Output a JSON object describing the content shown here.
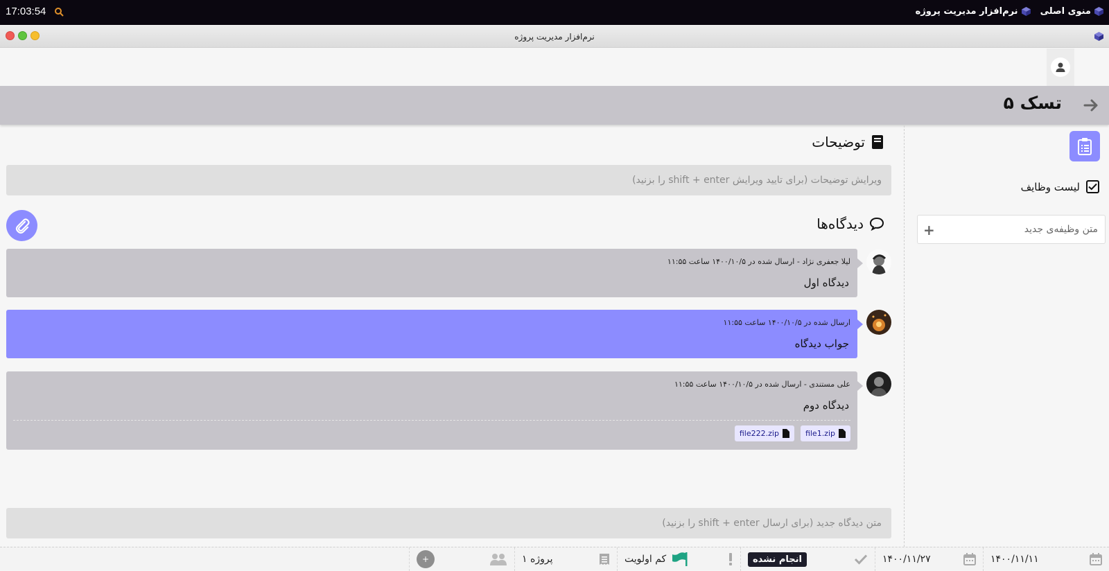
{
  "system_bar": {
    "clock": "17:03:54",
    "main_menu": "منوی اصلی",
    "app_name": "نرم‌افزار مدیریت پروژه"
  },
  "window": {
    "title": "نرم‌افزار مدیریت پروژه"
  },
  "task": {
    "title": "تسک ۵"
  },
  "description": {
    "heading": "توضیحات",
    "placeholder": "ویرایش توضیحات (برای تایید ویرایش shift + enter را بزنید)"
  },
  "comments": {
    "heading": "دیدگاه‌ها",
    "items": [
      {
        "meta": "لیلا جعفری نژاد - ارسال شده در ۱۴۰۰/۱۰/۵ ساعت ۱۱:۵۵",
        "text": "دیدگاه اول"
      },
      {
        "meta": "ارسال شده در ۱۴۰۰/۱۰/۵ ساعت ۱۱:۵۵",
        "text": "جواب دیدگاه"
      },
      {
        "meta": "علی مستندی - ارسال شده در ۱۴۰۰/۱۰/۵ ساعت ۱۱:۵۵",
        "text": "دیدگاه دوم",
        "files": [
          "file1.zip",
          "file222.zip"
        ]
      }
    ],
    "new_placeholder": "متن دیدگاه جدید (برای ارسال shift + enter را بزنید)"
  },
  "sidebar": {
    "task_list_label": "لیست وظایف",
    "new_task_placeholder": "متن وظیفه‌ی جدید",
    "add_symbol": "+"
  },
  "footer": {
    "start_date": "۱۴۰۰/۱۱/۱۱",
    "end_date": "۱۴۰۰/۱۱/۲۷",
    "status": "انجام نشده",
    "priority": "کم اولویت",
    "project": "پروژه ۱",
    "add_member_symbol": "+"
  },
  "colors": {
    "accent": "#8c8cff",
    "panel_grey": "#c6c4ca",
    "priority_flag": "#1ea383"
  }
}
